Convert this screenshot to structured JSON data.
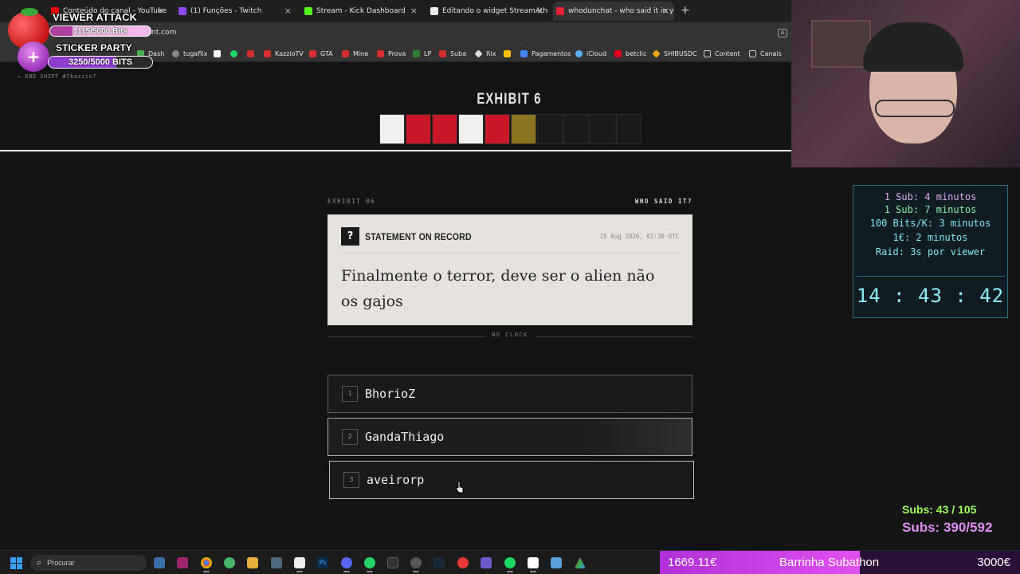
{
  "browser": {
    "tabs": [
      {
        "title": "Conteúdo do canal - YouTube Studio",
        "color": "#ff0000"
      },
      {
        "title": "(1) Funções - Twitch",
        "color": "#9146ff"
      },
      {
        "title": "Stream - Kick Dashboard",
        "color": "#53fc18"
      },
      {
        "title": "Editando o widget StreamAthon",
        "color": "#f0f0f0"
      },
      {
        "title": "whodunchat - who said it in your chat",
        "color": "#e8202e",
        "active": true
      }
    ],
    "url": "aint.com",
    "bookmarks": [
      "Dash",
      "tugaflix",
      "",
      "",
      "KazzioTV",
      "GTA",
      "Mine",
      "Prova",
      "LP",
      "Suba",
      "Rix",
      "",
      "Pagamentos",
      "iCloud",
      "betclic",
      "SHIBUSDC",
      "Content",
      "Canais"
    ]
  },
  "page": {
    "end_shift": "← END SHIFT  #7kazzio7",
    "exhibit_title": "EXHIBIT 6",
    "squares": [
      "#f0f0ee",
      "#c8182a",
      "#c8182a",
      "#f0f0ee",
      "#c8182a",
      "#8a7420",
      "#1a1a1a",
      "#1a1a1a",
      "#1a1a1a",
      "#1a1a1a"
    ],
    "exhibit_label": "EXHIBIT 06",
    "who_said": "WHO SAID IT?",
    "card": {
      "qmark": "?",
      "heading": "STATEMENT ON RECORD",
      "timestamp": "15 Aug 2026, 02:30 UTC",
      "quote": "Finalmente o terror, deve ser o alien não os gajos"
    },
    "no_clock": "NO CLOCK",
    "answers": [
      {
        "num": "1",
        "name": "BhorioZ"
      },
      {
        "num": "2",
        "name": "GandaThiago"
      },
      {
        "num": "3",
        "name": "aveirorp"
      }
    ]
  },
  "overlay": {
    "viewer_attack": "VIEWER ATTACK",
    "bits_text": "1115/5000 Bits",
    "bits_progress": 0.223,
    "sticker_party": "STICKER PARTY",
    "sticker_text": "3250/5000 BITS",
    "sticker_progress": 0.65,
    "timer_lines": [
      "1 Sub: 4 minutos",
      "1 Sub: 7 minutos",
      "100 Bits/K: 3 minutos",
      "1€: 2 minutos",
      "Raid: 3s por viewer"
    ],
    "clock": "14 : 43 : 42",
    "subs_line1": "Subs: 43 / 105",
    "subs_line2": "Subs: 390/592",
    "subathon": {
      "current": "1669.11€",
      "title": "Barrinha Subathon",
      "goal": "3000€",
      "progress": 0.556
    }
  },
  "taskbar": {
    "search_label": "Procurar"
  }
}
